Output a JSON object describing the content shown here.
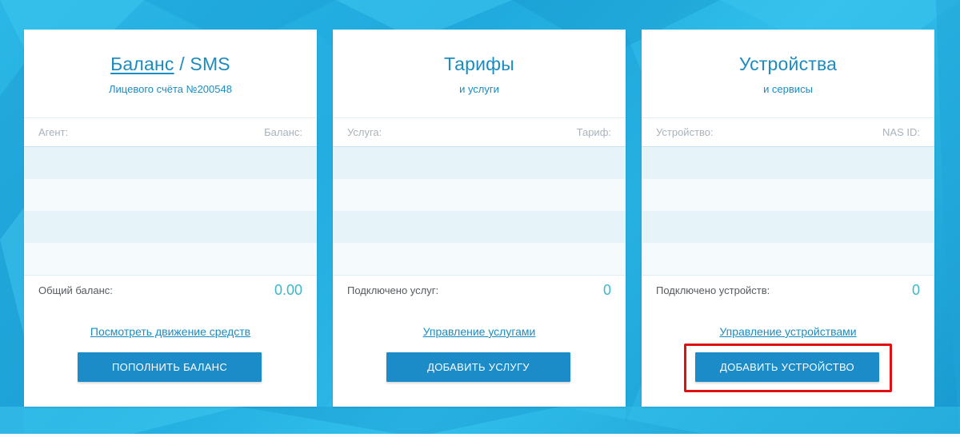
{
  "colors": {
    "background": "#22b2e3",
    "accent": "#1b8cc0",
    "button": "#1b8cc8",
    "value": "#3ab8ca",
    "highlight": "#e01010"
  },
  "cards": [
    {
      "title_link": "Баланс",
      "title_sep": "/",
      "title_rest": "SMS",
      "subtitle": "Лицевого счёта №200548",
      "col_left": "Агент:",
      "col_right": "Баланс:",
      "total_label": "Общий баланс:",
      "total_value": "0.00",
      "link": "Посмотреть движение средств",
      "button": "ПОПОЛНИТЬ БАЛАНС"
    },
    {
      "title": "Тарифы",
      "subtitle": "и услуги",
      "col_left": "Услуга:",
      "col_right": "Тариф:",
      "total_label": "Подключено услуг:",
      "total_value": "0",
      "link": "Управление услугами",
      "button": "ДОБАВИТЬ УСЛУГУ"
    },
    {
      "title": "Устройства",
      "subtitle": "и сервисы",
      "col_left": "Устройство:",
      "col_right": "NAS ID:",
      "total_label": "Подключено устройств:",
      "total_value": "0",
      "link": "Управление устройствами",
      "button": "ДОБАВИТЬ УСТРОЙСТВО"
    }
  ]
}
